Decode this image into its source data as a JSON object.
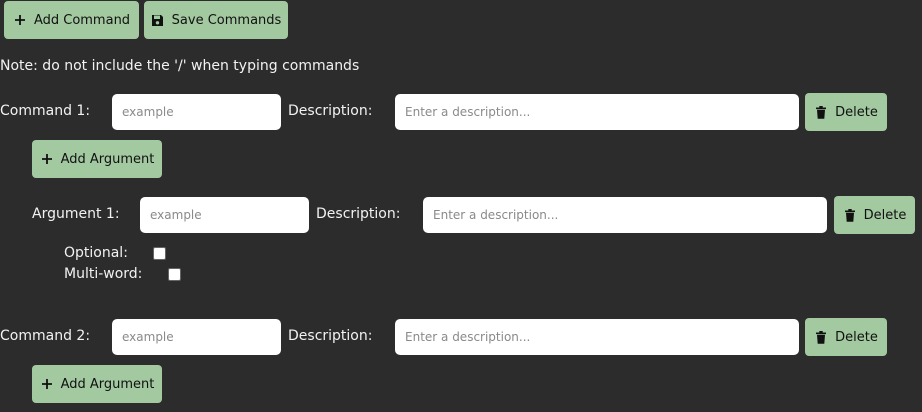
{
  "toolbar": {
    "add_command_label": "Add Command",
    "save_commands_label": "Save Commands"
  },
  "note": "Note: do not include the '/' when typing commands",
  "commands": [
    {
      "label": "Command 1:",
      "name_placeholder": "example",
      "description_label": "Description:",
      "description_placeholder": "Enter a description...",
      "delete_label": "Delete",
      "add_argument_label": "Add Argument",
      "arguments": [
        {
          "label": "Argument 1:",
          "name_placeholder": "example",
          "description_label": "Description:",
          "description_placeholder": "Enter a description...",
          "delete_label": "Delete",
          "optional_label": "Optional:",
          "multiword_label": "Multi-word:"
        }
      ]
    },
    {
      "label": "Command 2:",
      "name_placeholder": "example",
      "description_label": "Description:",
      "description_placeholder": "Enter a description...",
      "delete_label": "Delete",
      "add_argument_label": "Add Argument"
    }
  ],
  "colors": {
    "background": "#2c2c2c",
    "button": "#a3c9a0",
    "text": "#f2f2f2"
  },
  "icons": {
    "add": "plus-icon",
    "save": "floppy-disk-icon",
    "delete": "trash-icon"
  }
}
